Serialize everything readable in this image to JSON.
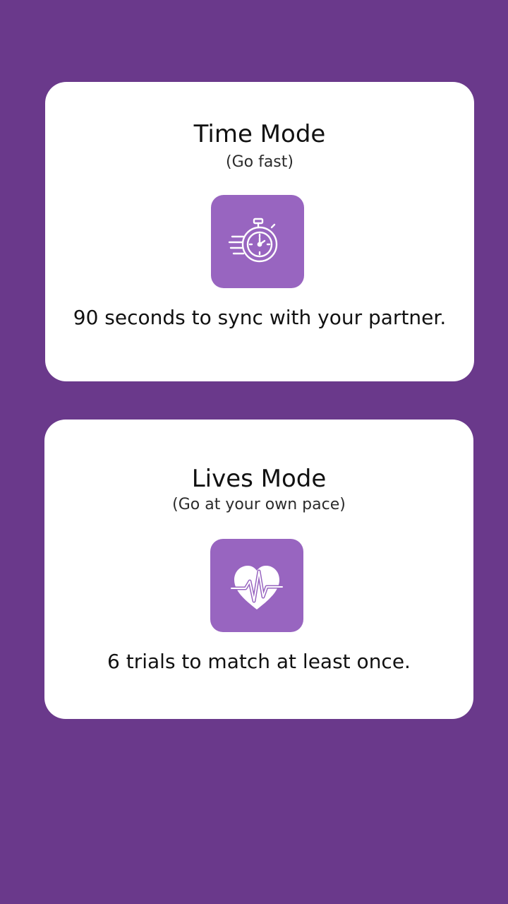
{
  "colors": {
    "background": "#6a398b",
    "card": "#ffffff",
    "icon_tile": "#9865c0"
  },
  "modes": [
    {
      "title": "Time Mode",
      "subtitle": "(Go fast)",
      "icon": "stopwatch-icon",
      "description": "90 seconds to sync with your partner."
    },
    {
      "title": "Lives Mode",
      "subtitle": "(Go at your own pace)",
      "icon": "heartbeat-icon",
      "description": "6 trials to match at least once."
    }
  ]
}
